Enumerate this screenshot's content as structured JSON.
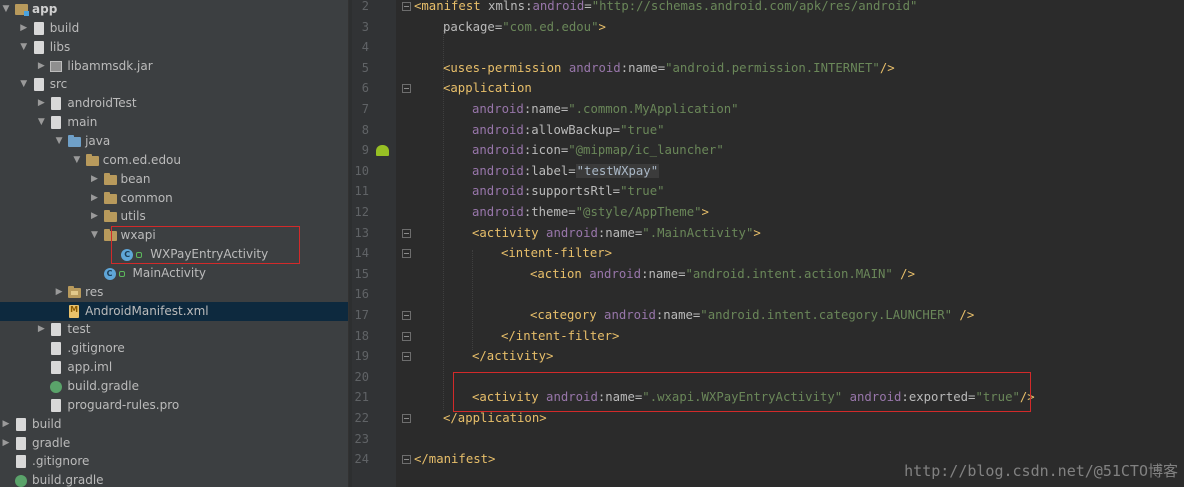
{
  "project_tree": {
    "items": [
      {
        "label": "app",
        "depth": 0,
        "expanded": true,
        "icon": "module-folder-icon"
      },
      {
        "label": "build",
        "depth": 1,
        "expanded": false,
        "icon": "folder-icon"
      },
      {
        "label": "libs",
        "depth": 1,
        "expanded": true,
        "icon": "folder-icon"
      },
      {
        "label": "libammsdk.jar",
        "depth": 2,
        "expanded": false,
        "icon": "jar-icon"
      },
      {
        "label": "src",
        "depth": 1,
        "expanded": true,
        "icon": "folder-icon"
      },
      {
        "label": "androidTest",
        "depth": 2,
        "expanded": false,
        "icon": "folder-icon"
      },
      {
        "label": "main",
        "depth": 2,
        "expanded": true,
        "icon": "folder-icon"
      },
      {
        "label": "java",
        "depth": 3,
        "expanded": true,
        "icon": "source-folder-icon"
      },
      {
        "label": "com.ed.edou",
        "depth": 4,
        "expanded": true,
        "icon": "package-icon"
      },
      {
        "label": "bean",
        "depth": 5,
        "expanded": false,
        "icon": "package-icon"
      },
      {
        "label": "common",
        "depth": 5,
        "expanded": false,
        "icon": "package-icon"
      },
      {
        "label": "utils",
        "depth": 5,
        "expanded": false,
        "icon": "package-icon"
      },
      {
        "label": "wxapi",
        "depth": 5,
        "expanded": true,
        "icon": "package-icon"
      },
      {
        "label": "WXPayEntryActivity",
        "depth": 6,
        "icon": "class-icon"
      },
      {
        "label": "MainActivity",
        "depth": 5,
        "icon": "class-icon"
      },
      {
        "label": "res",
        "depth": 3,
        "expanded": false,
        "icon": "resource-folder-icon"
      },
      {
        "label": "AndroidManifest.xml",
        "depth": 3,
        "icon": "manifest-file-icon",
        "selected": true
      },
      {
        "label": "test",
        "depth": 2,
        "expanded": false,
        "icon": "folder-icon"
      },
      {
        "label": ".gitignore",
        "depth": 2,
        "icon": "file-icon"
      },
      {
        "label": "app.iml",
        "depth": 2,
        "icon": "file-icon"
      },
      {
        "label": "build.gradle",
        "depth": 2,
        "icon": "gradle-icon"
      },
      {
        "label": "proguard-rules.pro",
        "depth": 2,
        "icon": "file-icon"
      },
      {
        "label": "build",
        "depth": 0,
        "expanded": false,
        "icon": "folder-icon"
      },
      {
        "label": "gradle",
        "depth": 0,
        "expanded": false,
        "icon": "folder-icon"
      },
      {
        "label": ".gitignore",
        "depth": 0,
        "icon": "file-icon"
      },
      {
        "label": "build.gradle",
        "depth": 0,
        "icon": "gradle-icon"
      }
    ]
  },
  "editor": {
    "file": "AndroidManifest.xml",
    "lines": [
      {
        "n": "2",
        "indent": 0,
        "tokens": [
          [
            "tag",
            "<manifest "
          ],
          [
            "attr",
            "xmlns:"
          ],
          [
            "ns",
            "android"
          ],
          [
            "attr",
            "="
          ],
          [
            "str",
            "\"http://schemas.android.com/apk/res/android\""
          ]
        ]
      },
      {
        "n": "3",
        "indent": 1,
        "tokens": [
          [
            "attr",
            "package="
          ],
          [
            "str",
            "\"com.ed.edou\""
          ],
          [
            "tag",
            ">"
          ]
        ]
      },
      {
        "n": "4",
        "indent": 0,
        "tokens": []
      },
      {
        "n": "5",
        "indent": 1,
        "tokens": [
          [
            "tag",
            "<uses-permission "
          ],
          [
            "ns",
            "android"
          ],
          [
            "attr",
            ":name="
          ],
          [
            "str",
            "\"android.permission.INTERNET\""
          ],
          [
            "tag",
            "/>"
          ]
        ]
      },
      {
        "n": "6",
        "indent": 1,
        "tokens": [
          [
            "tag",
            "<application"
          ]
        ]
      },
      {
        "n": "7",
        "indent": 2,
        "tokens": [
          [
            "ns",
            "android"
          ],
          [
            "attr",
            ":name="
          ],
          [
            "str",
            "\".common.MyApplication\""
          ]
        ]
      },
      {
        "n": "8",
        "indent": 2,
        "tokens": [
          [
            "ns",
            "android"
          ],
          [
            "attr",
            ":allowBackup="
          ],
          [
            "str",
            "\"true\""
          ]
        ]
      },
      {
        "n": "9",
        "indent": 2,
        "tokens": [
          [
            "ns",
            "android"
          ],
          [
            "attr",
            ":icon="
          ],
          [
            "str",
            "\"@mipmap/ic_launcher\""
          ]
        ]
      },
      {
        "n": "10",
        "indent": 2,
        "tokens": [
          [
            "ns",
            "android"
          ],
          [
            "attr",
            ":label="
          ],
          [
            "valbox",
            "\"testWXpay\""
          ]
        ]
      },
      {
        "n": "11",
        "indent": 2,
        "tokens": [
          [
            "ns",
            "android"
          ],
          [
            "attr",
            ":supportsRtl="
          ],
          [
            "str",
            "\"true\""
          ]
        ]
      },
      {
        "n": "12",
        "indent": 2,
        "tokens": [
          [
            "ns",
            "android"
          ],
          [
            "attr",
            ":theme="
          ],
          [
            "str",
            "\"@style/AppTheme\""
          ],
          [
            "tag",
            ">"
          ]
        ]
      },
      {
        "n": "13",
        "indent": 2,
        "tokens": [
          [
            "tag",
            "<activity "
          ],
          [
            "ns",
            "android"
          ],
          [
            "attr",
            ":name="
          ],
          [
            "str",
            "\".MainActivity\""
          ],
          [
            "tag",
            ">"
          ]
        ]
      },
      {
        "n": "14",
        "indent": 3,
        "tokens": [
          [
            "tag",
            "<intent-filter>"
          ]
        ]
      },
      {
        "n": "15",
        "indent": 4,
        "tokens": [
          [
            "tag",
            "<action "
          ],
          [
            "ns",
            "android"
          ],
          [
            "attr",
            ":name="
          ],
          [
            "str",
            "\"android.intent.action.MAIN\""
          ],
          [
            "tag",
            " />"
          ]
        ]
      },
      {
        "n": "16",
        "indent": 0,
        "tokens": []
      },
      {
        "n": "17",
        "indent": 4,
        "tokens": [
          [
            "tag",
            "<category "
          ],
          [
            "ns",
            "android"
          ],
          [
            "attr",
            ":name="
          ],
          [
            "str",
            "\"android.intent.category.LAUNCHER\""
          ],
          [
            "tag",
            " />"
          ]
        ]
      },
      {
        "n": "18",
        "indent": 3,
        "tokens": [
          [
            "tag",
            "</intent-filter>"
          ]
        ]
      },
      {
        "n": "19",
        "indent": 2,
        "tokens": [
          [
            "tag",
            "</activity>"
          ]
        ]
      },
      {
        "n": "20",
        "indent": 0,
        "tokens": []
      },
      {
        "n": "21",
        "indent": 2,
        "tokens": [
          [
            "tag",
            "<activity "
          ],
          [
            "ns",
            "android"
          ],
          [
            "attr",
            ":name="
          ],
          [
            "str",
            "\".wxapi.WXPayEntryActivity\""
          ],
          [
            "attr",
            " "
          ],
          [
            "ns",
            "android"
          ],
          [
            "attr",
            ":exported="
          ],
          [
            "str",
            "\"true\""
          ],
          [
            "tag",
            "/>"
          ]
        ]
      },
      {
        "n": "22",
        "indent": 1,
        "tokens": [
          [
            "tag",
            "</application>"
          ]
        ]
      },
      {
        "n": "23",
        "indent": 0,
        "tokens": []
      },
      {
        "n": "24",
        "indent": 0,
        "tokens": [
          [
            "tag",
            "</manifest>"
          ]
        ]
      }
    ]
  },
  "watermark": "http://blog.csdn.net/@51CTO博客",
  "colors": {
    "tree_bg": "#3c3f41",
    "editor_bg": "#2b2b2b",
    "gutter_bg": "#313335",
    "selection": "#0d293e",
    "highlight_box": "#d22a2a",
    "xml_tag": "#e8bf6a",
    "xml_namespace": "#9876aa",
    "xml_string": "#6a8759"
  }
}
